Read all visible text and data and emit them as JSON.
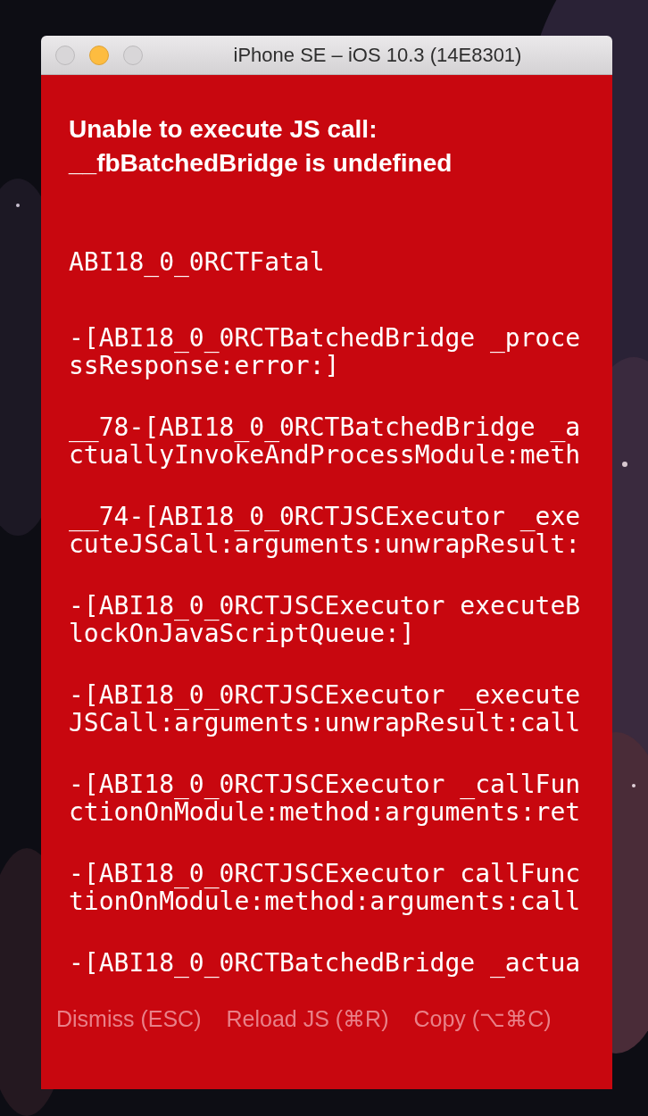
{
  "window": {
    "title": "iPhone SE – iOS 10.3 (14E8301)"
  },
  "error": {
    "message": "Unable to execute JS call: __fbBatchedBridge is undefined",
    "stack": [
      "ABI18_0_0RCTFatal",
      "-[ABI18_0_0RCTBatchedBridge _processResponse:error:]",
      "__78-[ABI18_0_0RCTBatchedBridge _actuallyInvokeAndProcessModule:meth",
      "__74-[ABI18_0_0RCTJSCExecutor _executeJSCall:arguments:unwrapResult:",
      "-[ABI18_0_0RCTJSCExecutor executeBlockOnJavaScriptQueue:]",
      "-[ABI18_0_0RCTJSCExecutor _executeJSCall:arguments:unwrapResult:call",
      "-[ABI18_0_0RCTJSCExecutor _callFunctionOnModule:method:arguments:ret",
      "-[ABI18_0_0RCTJSCExecutor callFunctionOnModule:method:arguments:call",
      "-[ABI18_0_0RCTBatchedBridge _actua"
    ]
  },
  "buttons": [
    "Dismiss (ESC)",
    "Reload JS (⌘R)",
    "Copy (⌥⌘C)"
  ]
}
